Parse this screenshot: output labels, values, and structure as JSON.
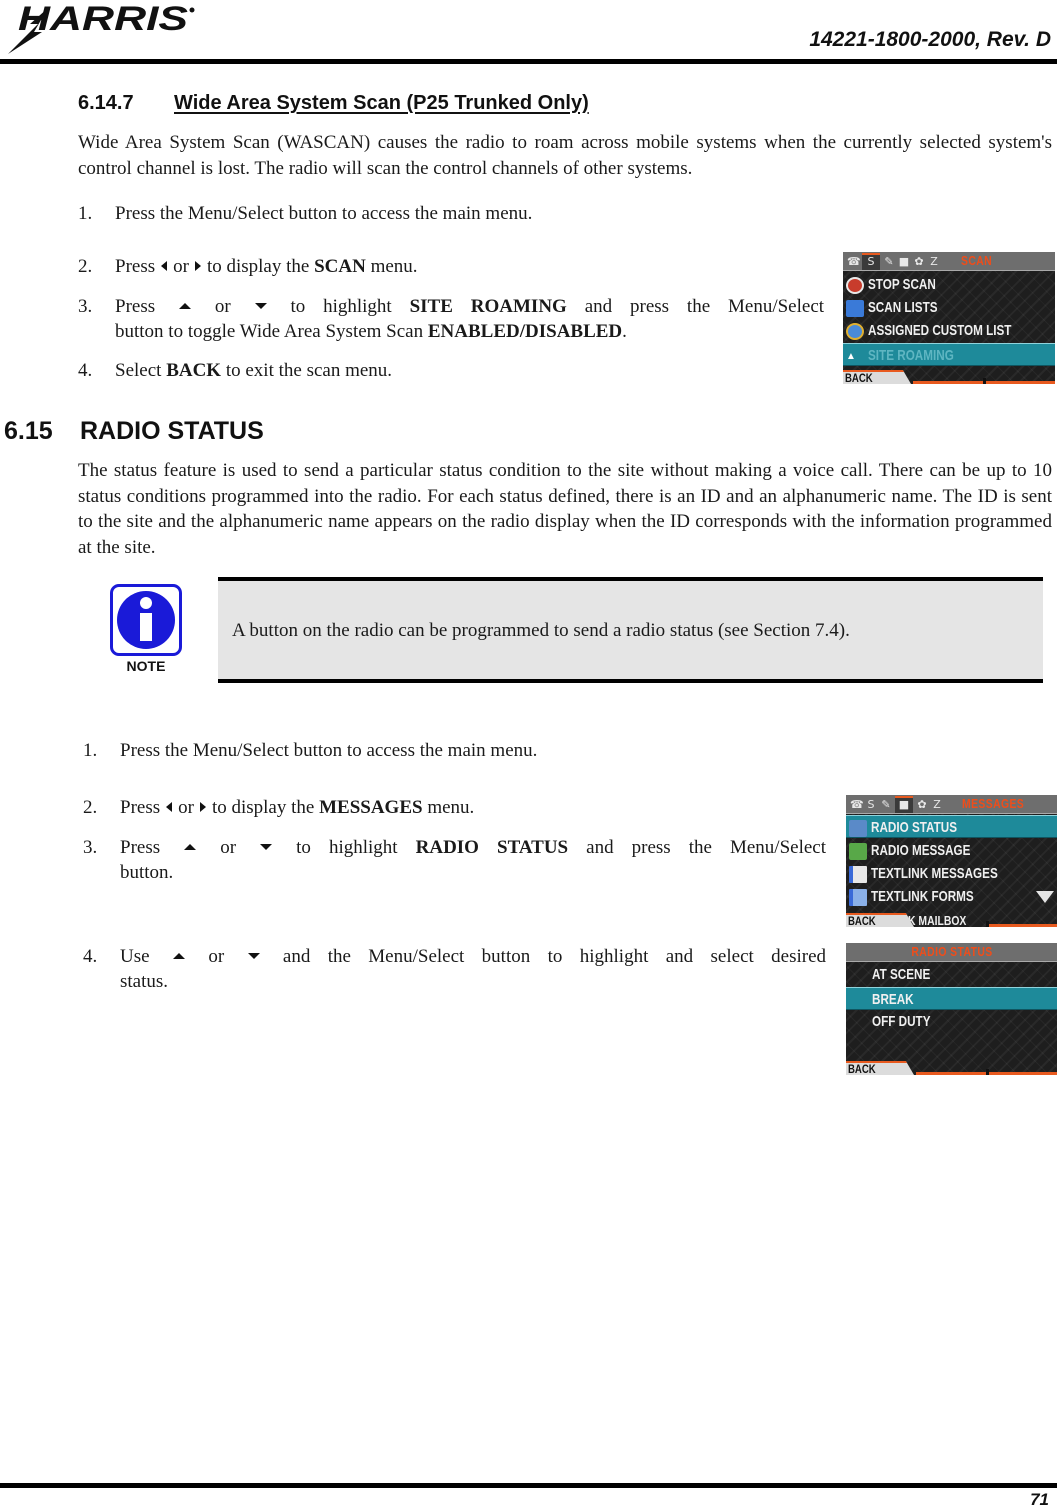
{
  "header": {
    "logo_text": "HARRIS",
    "doc_number": "14221-1800-2000, Rev. D"
  },
  "section_wascan": {
    "number": "6.14.7",
    "title": "Wide Area System Scan (P25 Trunked Only)",
    "intro": "Wide Area System Scan (WASCAN) causes the radio to roam across mobile systems when the currently selected system's control channel is lost. The radio will scan the control channels of other systems.",
    "steps": [
      {
        "n": "1.",
        "text": "Press the Menu/Select button to access the main menu."
      },
      {
        "n": "2.",
        "pre": "Press",
        "mid": "or",
        "post": "to display the",
        "bold": "SCAN",
        "tail": "menu."
      },
      {
        "n": "3.",
        "pre": "Press",
        "mid": "or",
        "post": "to highlight",
        "bold": "SITE ROAMING",
        "tail": "and press the Menu/Select",
        "cont_pre": "button to toggle Wide Area System Scan",
        "cont_bold": "ENABLED/DISABLED",
        "cont_tail": "."
      },
      {
        "n": "4.",
        "pre": "Select",
        "bold": "BACK",
        "tail": "to exit the scan menu."
      }
    ]
  },
  "section_status": {
    "number": "6.15",
    "title": "RADIO STATUS",
    "intro": "The status feature is used to send a particular status condition to the site without making a voice call. There can be up to 10 status conditions programmed into the radio. For each status defined, there is an ID and an alphanumeric name. The ID is sent to the site and the alphanumeric name appears on the radio display when the ID corresponds with the information programmed at the site.",
    "note_label": "NOTE",
    "note_text": "A button on the radio can be programmed to send a radio status (see Section 7.4).",
    "steps": [
      {
        "n": "1.",
        "text": "Press the Menu/Select button to access the main menu."
      },
      {
        "n": "2.",
        "pre": "Press",
        "mid": "or",
        "post": "to display the",
        "bold": "MESSAGES",
        "tail": "menu."
      },
      {
        "n": "3.",
        "pre": "Press",
        "mid": "or",
        "post": "to highlight",
        "bold": "RADIO STATUS",
        "tail": "and press the Menu/Select",
        "cont": "button."
      },
      {
        "n": "4.",
        "pre": "Use",
        "mid": "or",
        "post": "and the Menu/Select button to highlight and select desired",
        "cont": "status."
      }
    ]
  },
  "screens": {
    "scan": {
      "title": "SCAN",
      "items": [
        "STOP SCAN",
        "SCAN LISTS",
        "ASSIGNED CUSTOM LIST",
        "SITE ROAMING"
      ],
      "selected_index": 3,
      "back": "BACK"
    },
    "messages": {
      "title": "MESSAGES",
      "items": [
        "RADIO STATUS",
        "RADIO MESSAGE",
        "TEXTLINK MESSAGES",
        "TEXTLINK FORMS"
      ],
      "partial_item": "K MAILBOX",
      "selected_index": 0,
      "back": "BACK"
    },
    "status": {
      "title": "RADIO STATUS",
      "items": [
        "AT SCENE",
        "BREAK",
        "OFF DUTY"
      ],
      "selected_index": 1,
      "back": "BACK"
    }
  },
  "colors": {
    "screen_highlight": "#1e8a9a",
    "screen_title": "#ef4d1a",
    "note_icon_blue": "#1a1ad8",
    "note_bg": "#e5e5e5"
  },
  "footer": {
    "page_number": "71"
  }
}
